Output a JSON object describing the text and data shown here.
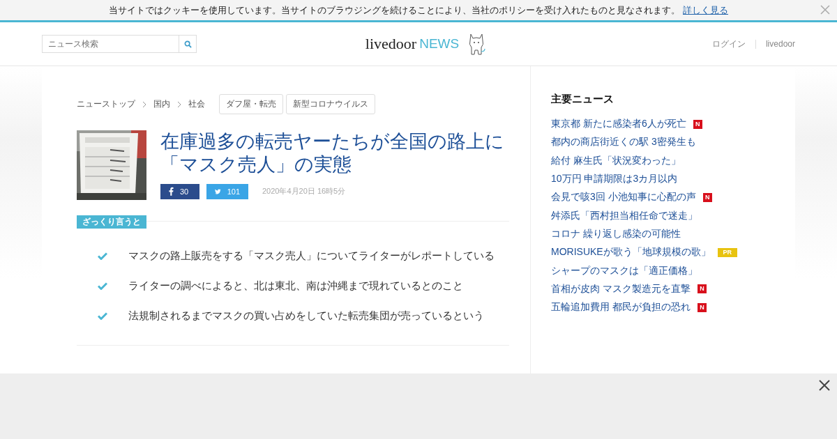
{
  "cookie_bar": {
    "text": "当サイトではクッキーを使用しています。当サイトのブラウジングを続けることにより、当社のポリシーを受け入れたものと見なされます。",
    "link": "詳しく見る"
  },
  "header": {
    "search": {
      "placeholder": "ニュース検索"
    },
    "logo": {
      "brand": "livedoor",
      "section": "NEWS"
    },
    "links": [
      "ログイン",
      "livedoor"
    ]
  },
  "breadcrumbs": [
    "ニューストップ",
    "国内",
    "社会"
  ],
  "tags": [
    "ダフ屋・転売",
    "新型コロナウイルス"
  ],
  "article": {
    "title": "在庫過多の転売ヤーたちが全国の路上に「マスク売人」の実態",
    "share": [
      {
        "kind": "facebook",
        "count": "30"
      },
      {
        "kind": "twitter",
        "count": "101"
      }
    ],
    "date": "2020年4月20日 16時5分",
    "summary_label": "ざっくり言うと",
    "summary": [
      "マスクの路上販売をする「マスク売人」についてライターがレポートしている",
      "ライターの調べによると、北は東北、南は沖縄まで現れているとのこと",
      "法規制されるまでマスクの買い占めをしていた転売集団が売っているという"
    ]
  },
  "sidebar": {
    "title": "主要ニュース",
    "items": [
      {
        "title": "東京都 新たに感染者6人が死亡",
        "badge": {
          "kind": "new",
          "label": "N"
        }
      },
      {
        "title": "都内の商店街近くの駅 3密発生も"
      },
      {
        "title": "給付 麻生氏「状況変わった」"
      },
      {
        "title": "10万円 申請期限は3カ月以内"
      },
      {
        "title": "会見で咳3回 小池知事に心配の声",
        "badge": {
          "kind": "new",
          "label": "N"
        }
      },
      {
        "title": "舛添氏「西村担当相任命で迷走」"
      },
      {
        "title": "コロナ 繰り返し感染の可能性"
      },
      {
        "title": "MORISUKEが歌う「地球規模の歌」",
        "badge": {
          "kind": "pr",
          "label": "PR"
        }
      },
      {
        "title": "シャープのマスクは「適正価格」"
      },
      {
        "title": "首相が皮肉 マスク製造元を直撃",
        "badge": {
          "kind": "new",
          "label": "N"
        }
      },
      {
        "title": "五輪追加費用 都民が負担の恐れ",
        "badge": {
          "kind": "new",
          "label": "N"
        }
      }
    ]
  }
}
